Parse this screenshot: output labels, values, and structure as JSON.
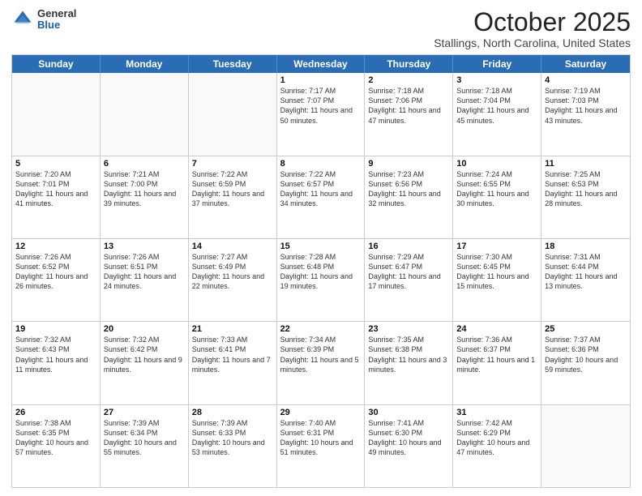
{
  "logo": {
    "general": "General",
    "blue": "Blue"
  },
  "header": {
    "month": "October 2025",
    "location": "Stallings, North Carolina, United States"
  },
  "weekdays": [
    "Sunday",
    "Monday",
    "Tuesday",
    "Wednesday",
    "Thursday",
    "Friday",
    "Saturday"
  ],
  "weeks": [
    [
      {
        "day": "",
        "info": ""
      },
      {
        "day": "",
        "info": ""
      },
      {
        "day": "",
        "info": ""
      },
      {
        "day": "1",
        "info": "Sunrise: 7:17 AM\nSunset: 7:07 PM\nDaylight: 11 hours and 50 minutes."
      },
      {
        "day": "2",
        "info": "Sunrise: 7:18 AM\nSunset: 7:06 PM\nDaylight: 11 hours and 47 minutes."
      },
      {
        "day": "3",
        "info": "Sunrise: 7:18 AM\nSunset: 7:04 PM\nDaylight: 11 hours and 45 minutes."
      },
      {
        "day": "4",
        "info": "Sunrise: 7:19 AM\nSunset: 7:03 PM\nDaylight: 11 hours and 43 minutes."
      }
    ],
    [
      {
        "day": "5",
        "info": "Sunrise: 7:20 AM\nSunset: 7:01 PM\nDaylight: 11 hours and 41 minutes."
      },
      {
        "day": "6",
        "info": "Sunrise: 7:21 AM\nSunset: 7:00 PM\nDaylight: 11 hours and 39 minutes."
      },
      {
        "day": "7",
        "info": "Sunrise: 7:22 AM\nSunset: 6:59 PM\nDaylight: 11 hours and 37 minutes."
      },
      {
        "day": "8",
        "info": "Sunrise: 7:22 AM\nSunset: 6:57 PM\nDaylight: 11 hours and 34 minutes."
      },
      {
        "day": "9",
        "info": "Sunrise: 7:23 AM\nSunset: 6:56 PM\nDaylight: 11 hours and 32 minutes."
      },
      {
        "day": "10",
        "info": "Sunrise: 7:24 AM\nSunset: 6:55 PM\nDaylight: 11 hours and 30 minutes."
      },
      {
        "day": "11",
        "info": "Sunrise: 7:25 AM\nSunset: 6:53 PM\nDaylight: 11 hours and 28 minutes."
      }
    ],
    [
      {
        "day": "12",
        "info": "Sunrise: 7:26 AM\nSunset: 6:52 PM\nDaylight: 11 hours and 26 minutes."
      },
      {
        "day": "13",
        "info": "Sunrise: 7:26 AM\nSunset: 6:51 PM\nDaylight: 11 hours and 24 minutes."
      },
      {
        "day": "14",
        "info": "Sunrise: 7:27 AM\nSunset: 6:49 PM\nDaylight: 11 hours and 22 minutes."
      },
      {
        "day": "15",
        "info": "Sunrise: 7:28 AM\nSunset: 6:48 PM\nDaylight: 11 hours and 19 minutes."
      },
      {
        "day": "16",
        "info": "Sunrise: 7:29 AM\nSunset: 6:47 PM\nDaylight: 11 hours and 17 minutes."
      },
      {
        "day": "17",
        "info": "Sunrise: 7:30 AM\nSunset: 6:45 PM\nDaylight: 11 hours and 15 minutes."
      },
      {
        "day": "18",
        "info": "Sunrise: 7:31 AM\nSunset: 6:44 PM\nDaylight: 11 hours and 13 minutes."
      }
    ],
    [
      {
        "day": "19",
        "info": "Sunrise: 7:32 AM\nSunset: 6:43 PM\nDaylight: 11 hours and 11 minutes."
      },
      {
        "day": "20",
        "info": "Sunrise: 7:32 AM\nSunset: 6:42 PM\nDaylight: 11 hours and 9 minutes."
      },
      {
        "day": "21",
        "info": "Sunrise: 7:33 AM\nSunset: 6:41 PM\nDaylight: 11 hours and 7 minutes."
      },
      {
        "day": "22",
        "info": "Sunrise: 7:34 AM\nSunset: 6:39 PM\nDaylight: 11 hours and 5 minutes."
      },
      {
        "day": "23",
        "info": "Sunrise: 7:35 AM\nSunset: 6:38 PM\nDaylight: 11 hours and 3 minutes."
      },
      {
        "day": "24",
        "info": "Sunrise: 7:36 AM\nSunset: 6:37 PM\nDaylight: 11 hours and 1 minute."
      },
      {
        "day": "25",
        "info": "Sunrise: 7:37 AM\nSunset: 6:36 PM\nDaylight: 10 hours and 59 minutes."
      }
    ],
    [
      {
        "day": "26",
        "info": "Sunrise: 7:38 AM\nSunset: 6:35 PM\nDaylight: 10 hours and 57 minutes."
      },
      {
        "day": "27",
        "info": "Sunrise: 7:39 AM\nSunset: 6:34 PM\nDaylight: 10 hours and 55 minutes."
      },
      {
        "day": "28",
        "info": "Sunrise: 7:39 AM\nSunset: 6:33 PM\nDaylight: 10 hours and 53 minutes."
      },
      {
        "day": "29",
        "info": "Sunrise: 7:40 AM\nSunset: 6:31 PM\nDaylight: 10 hours and 51 minutes."
      },
      {
        "day": "30",
        "info": "Sunrise: 7:41 AM\nSunset: 6:30 PM\nDaylight: 10 hours and 49 minutes."
      },
      {
        "day": "31",
        "info": "Sunrise: 7:42 AM\nSunset: 6:29 PM\nDaylight: 10 hours and 47 minutes."
      },
      {
        "day": "",
        "info": ""
      }
    ]
  ]
}
